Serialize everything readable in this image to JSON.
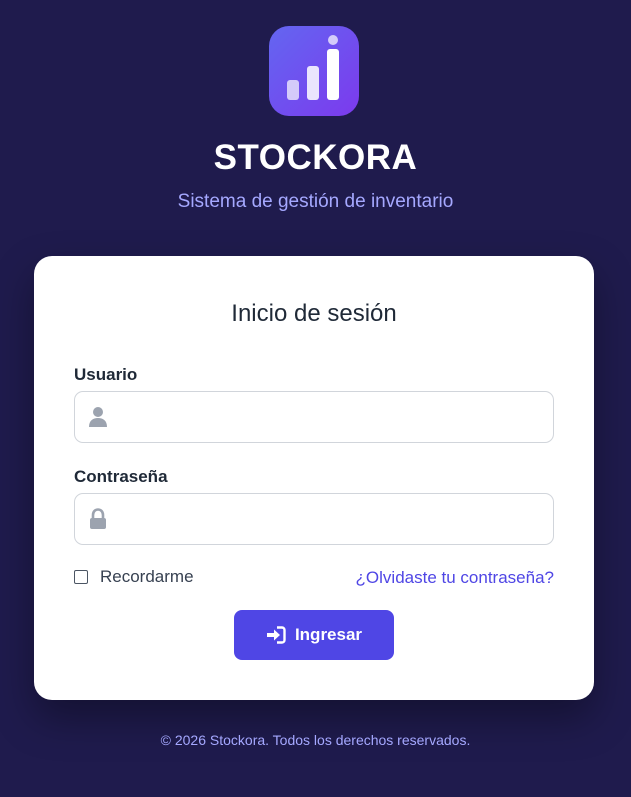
{
  "brand": {
    "logo_icon": "bar-chart-icon",
    "name": "STOCKORA",
    "tagline": "Sistema de gestión de inventario"
  },
  "login": {
    "title": "Inicio de sesión",
    "username": {
      "label": "Usuario",
      "icon": "user-icon",
      "value": "",
      "placeholder": ""
    },
    "password": {
      "label": "Contraseña",
      "icon": "lock-icon",
      "value": "",
      "placeholder": ""
    },
    "remember_label": "Recordarme",
    "remember_checked": false,
    "forgot_link": "¿Olvidaste tu contraseña?",
    "submit_label": "Ingresar",
    "submit_icon": "sign-in-icon"
  },
  "footer": {
    "text": "© 2026 Stockora. Todos los derechos reservados."
  },
  "colors": {
    "background": "#1f1b4d",
    "accent": "#4f46e5",
    "accent_light": "#a5a8ff",
    "card": "#ffffff"
  }
}
